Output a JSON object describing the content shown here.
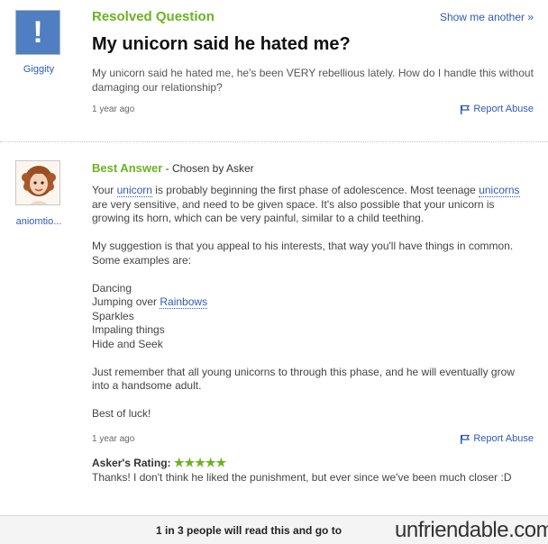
{
  "question": {
    "status": "Resolved Question",
    "show_another": "Show me another »",
    "title": "My unicorn said he hated me?",
    "body": "My unicorn said he hated me, he's been VERY rebellious lately. How do I handle this without damaging our relationship?",
    "time": "1 year ago",
    "report": "Report Abuse",
    "asker": "Giggity",
    "avatar_glyph": "!"
  },
  "answer": {
    "label": "Best Answer",
    "chosen": " - Chosen by Asker",
    "user": "aniomtio...",
    "para1": {
      "t1": "Your ",
      "link1": "unicorn",
      "t2": " is probably beginning the first phase of adolescence. Most teenage ",
      "link2": "unicorns",
      "t3": " are very sensitive, and need to be given space. It's also possible that your unicorn is growing its horn, which can be very painful, similar to a child teething."
    },
    "para2": "My suggestion is that you appeal to his interests, that way you'll have things in common. Some examples are:",
    "list": {
      "item1": "Dancing",
      "item2_prefix": "Jumping over ",
      "item2_link": "Rainbows",
      "item3": "Sparkles",
      "item4": "Impaling things",
      "item5": "Hide and Seek"
    },
    "para3": "Just remember that all young unicorns to through this phase, and he will eventually grow into a handsome adult.",
    "para4": "Best of luck!",
    "time": "1 year ago",
    "report": "Report Abuse",
    "rating_label": "Asker's Rating: ",
    "stars": "★★★★★",
    "rating_value": 5,
    "thanks": "Thanks! I don't think he liked the punishment, but ever since we've been much closer :D"
  },
  "footer": {
    "text": "1 in 3 people will read this and go to",
    "brand": "unfriendable.com"
  },
  "colors": {
    "accent_green": "#6bb321",
    "link_blue": "#2f5bb3"
  }
}
